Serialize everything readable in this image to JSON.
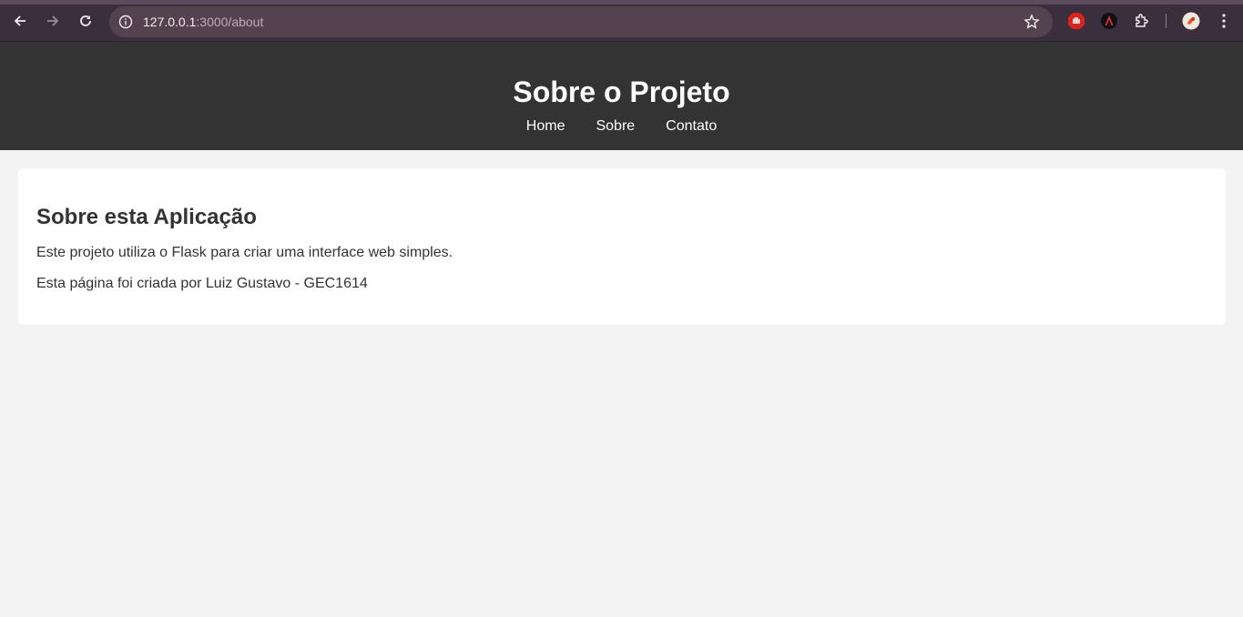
{
  "browser": {
    "url_host": "127.0.0.1",
    "url_path": ":3000/about"
  },
  "site": {
    "title": "Sobre o Projeto",
    "nav": [
      {
        "label": "Home"
      },
      {
        "label": "Sobre"
      },
      {
        "label": "Contato"
      }
    ]
  },
  "content": {
    "heading": "Sobre esta Aplicação",
    "paragraphs": [
      "Este projeto utiliza o Flask para criar uma interface web simples.",
      "Esta página foi criada por Luiz Gustavo - GEC1614"
    ]
  },
  "colors": {
    "chrome": "#3c2f3d",
    "omnibox": "#54424f",
    "header": "#333333",
    "page_bg": "#f3f3f3",
    "card_bg": "#ffffff"
  },
  "icons": [
    "back-icon",
    "forward-icon",
    "reload-icon",
    "site-info-icon",
    "bookmark-star-icon",
    "extension-adblock-icon",
    "extension-angular-icon",
    "extensions-puzzle-icon",
    "profile-avatar-icon",
    "menu-kebab-icon"
  ]
}
